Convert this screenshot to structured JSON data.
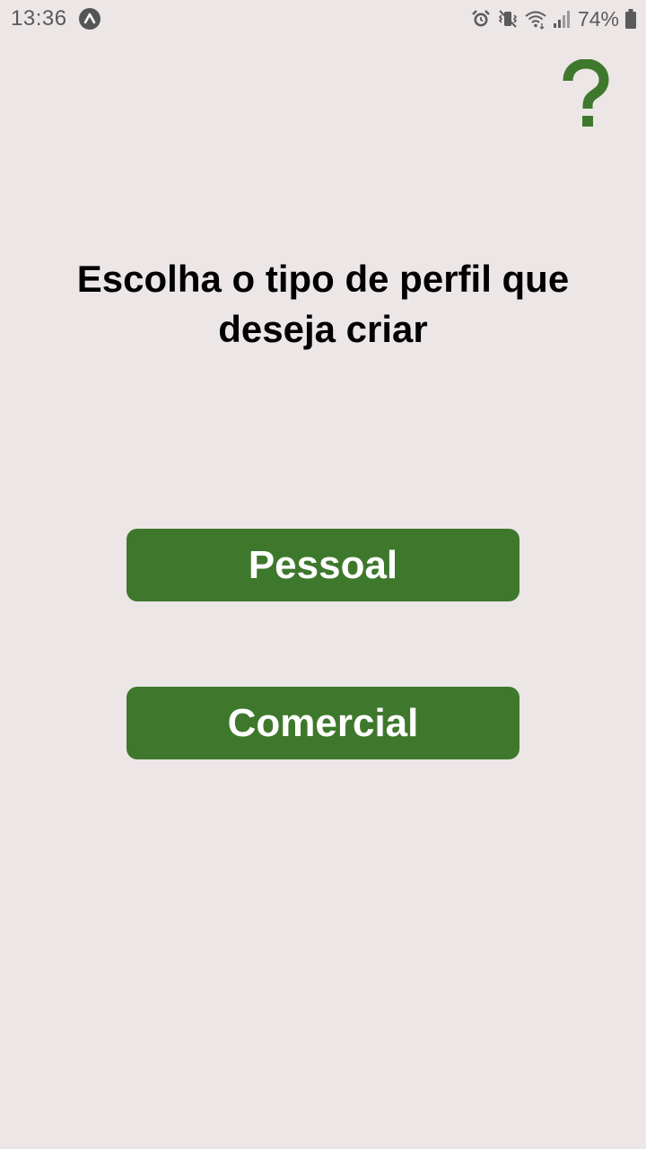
{
  "status_bar": {
    "time": "13:36",
    "battery": "74%",
    "icons": [
      "app-notification-icon",
      "alarm-icon",
      "vibrate-icon",
      "wifi-icon",
      "signal-icon",
      "battery-icon"
    ]
  },
  "header": {
    "help_symbol": "?",
    "help_icon": "question-mark-icon"
  },
  "main": {
    "title": "Escolha o tipo de perfil que deseja criar",
    "buttons": [
      {
        "label": "Pessoal"
      },
      {
        "label": "Comercial"
      }
    ]
  },
  "colors": {
    "background": "#ece6e6",
    "accent": "#3e782c",
    "button_text": "#ffffff",
    "title_text": "#000000"
  }
}
